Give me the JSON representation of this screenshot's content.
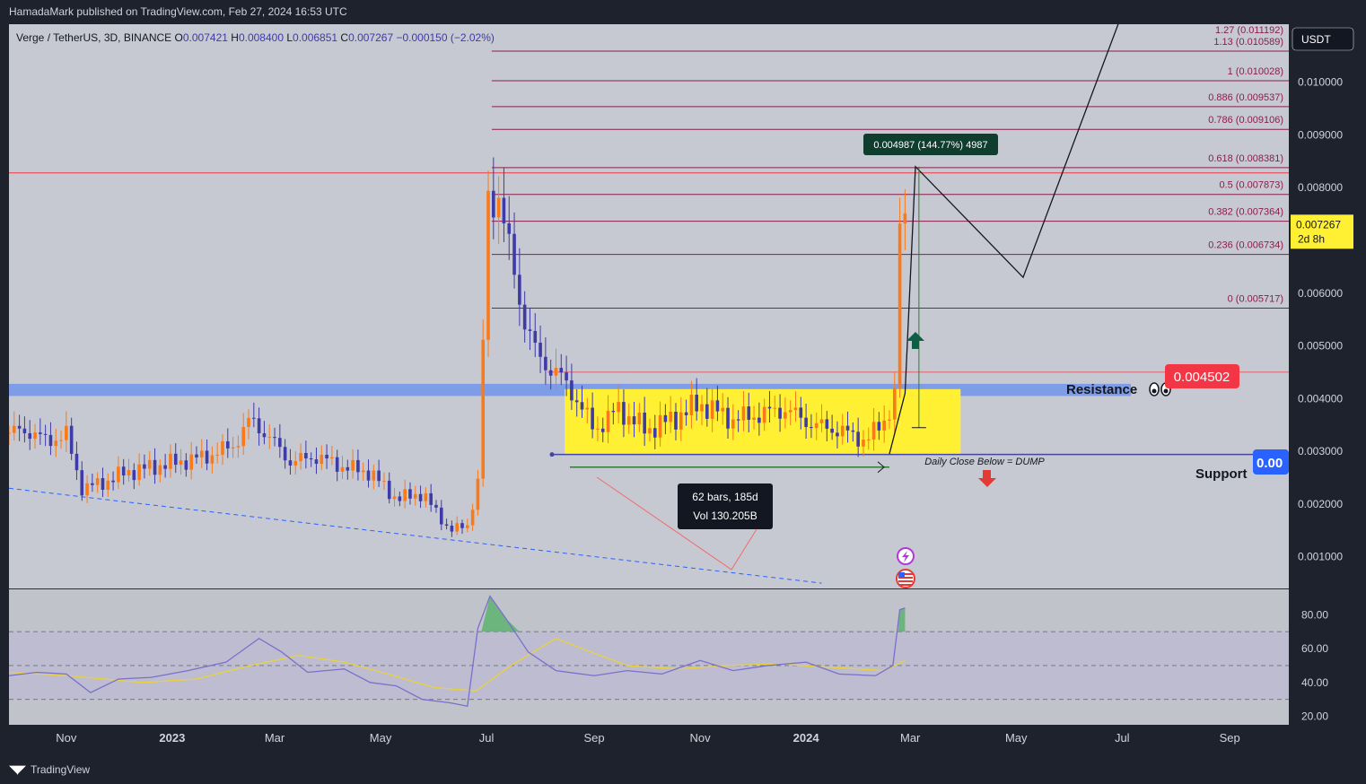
{
  "header": {
    "publisher": "HamadaMark published on TradingView.com, Feb 27, 2024 16:53 UTC"
  },
  "footer": {
    "brand": "TradingView",
    "logo": "tradingview-logo-icon"
  },
  "legend": {
    "symbol": "Verge / TetherUS, 3D, BINANCE",
    "open_label": "O",
    "open": "0.007421",
    "high_label": "H",
    "high": "0.008400",
    "low_label": "L",
    "low": "0.006851",
    "close_label": "C",
    "close": "0.007267",
    "change": "−0.000150 (−2.02%)"
  },
  "currency": "USDT",
  "price_label": {
    "value": "0.007267",
    "countdown": "2d 8h"
  },
  "colors": {
    "background": "#c6c9d1",
    "rsi_background": "#c1c3ca",
    "up": "#fb7a17",
    "down": "#3e3aa8",
    "fib": "#8a1d4c",
    "range_box": "#fff033",
    "resistance_band": "#7f9ce6",
    "support_line": "#4646a0",
    "rsi": "#7b6fcc",
    "rsi_ma": "#e8d23c",
    "resistance_badge": "#f23645",
    "support_badge": "#2962ff",
    "measure_label": "#0f3d2e"
  },
  "chart_data": {
    "type": "candlestick",
    "interval": "3D",
    "x_range": [
      "2022-09-29",
      "2024-10-05"
    ],
    "x_ticks": [
      {
        "date": "2022-11-01",
        "label": "Nov",
        "bold": false
      },
      {
        "date": "2023-01-01",
        "label": "2023",
        "bold": true
      },
      {
        "date": "2023-03-01",
        "label": "Mar",
        "bold": false
      },
      {
        "date": "2023-05-01",
        "label": "May",
        "bold": false
      },
      {
        "date": "2023-07-01",
        "label": "Jul",
        "bold": false
      },
      {
        "date": "2023-09-01",
        "label": "Sep",
        "bold": false
      },
      {
        "date": "2023-11-01",
        "label": "Nov",
        "bold": false
      },
      {
        "date": "2024-01-01",
        "label": "2024",
        "bold": true
      },
      {
        "date": "2024-03-01",
        "label": "Mar",
        "bold": false
      },
      {
        "date": "2024-05-01",
        "label": "May",
        "bold": false
      },
      {
        "date": "2024-07-01",
        "label": "Jul",
        "bold": false
      },
      {
        "date": "2024-09-01",
        "label": "Sep",
        "bold": false
      }
    ],
    "ylim": [
      0.0004,
      0.0111
    ],
    "y_ticks": [
      "0.001000",
      "0.002000",
      "0.003000",
      "0.004000",
      "0.005000",
      "0.006000",
      "0.008000",
      "0.009000",
      "0.010000"
    ],
    "close_path": [
      [
        "2022-09-29",
        0.00335
      ],
      [
        "2022-10-10",
        0.0034
      ],
      [
        "2022-10-20",
        0.0032
      ],
      [
        "2022-11-01",
        0.0033
      ],
      [
        "2022-11-10",
        0.0023
      ],
      [
        "2022-11-22",
        0.0024
      ],
      [
        "2022-12-05",
        0.0026
      ],
      [
        "2022-12-20",
        0.0027
      ],
      [
        "2023-01-05",
        0.0028
      ],
      [
        "2023-01-20",
        0.0029
      ],
      [
        "2023-02-05",
        0.0031
      ],
      [
        "2023-02-15",
        0.0036
      ],
      [
        "2023-02-25",
        0.0033
      ],
      [
        "2023-03-10",
        0.0028
      ],
      [
        "2023-03-25",
        0.0029
      ],
      [
        "2023-04-10",
        0.0027
      ],
      [
        "2023-04-25",
        0.0026
      ],
      [
        "2023-05-10",
        0.0021
      ],
      [
        "2023-05-25",
        0.0022
      ],
      [
        "2023-06-10",
        0.0015
      ],
      [
        "2023-06-20",
        0.0016
      ],
      [
        "2023-06-26",
        0.0024
      ],
      [
        "2023-07-02",
        0.0077
      ],
      [
        "2023-07-08",
        0.0079
      ],
      [
        "2023-07-14",
        0.0068
      ],
      [
        "2023-07-22",
        0.0056
      ],
      [
        "2023-07-30",
        0.0048
      ],
      [
        "2023-08-10",
        0.0045
      ],
      [
        "2023-08-20",
        0.0041
      ],
      [
        "2023-09-01",
        0.0034
      ],
      [
        "2023-09-15",
        0.0038
      ],
      [
        "2023-10-01",
        0.0034
      ],
      [
        "2023-10-15",
        0.0036
      ],
      [
        "2023-11-01",
        0.0039
      ],
      [
        "2023-11-20",
        0.0036
      ],
      [
        "2023-12-05",
        0.0037
      ],
      [
        "2023-12-20",
        0.0038
      ],
      [
        "2024-01-05",
        0.0035
      ],
      [
        "2024-01-20",
        0.0034
      ],
      [
        "2024-02-05",
        0.0032
      ],
      [
        "2024-02-15",
        0.0036
      ],
      [
        "2024-02-21",
        0.004
      ],
      [
        "2024-02-24",
        0.0073
      ],
      [
        "2024-02-27",
        0.007267
      ]
    ],
    "annotations": {
      "fib_levels": [
        {
          "ratio": "0",
          "price": 0.005717,
          "label": "0 (0.005717)"
        },
        {
          "ratio": "0.236",
          "price": 0.006734,
          "label": "0.236 (0.006734)"
        },
        {
          "ratio": "0.382",
          "price": 0.007364,
          "label": "0.382 (0.007364)"
        },
        {
          "ratio": "0.5",
          "price": 0.007873,
          "label": "0.5 (0.007873)"
        },
        {
          "ratio": "0.618",
          "price": 0.008381,
          "label": "0.618 (0.008381)"
        },
        {
          "ratio": "0.786",
          "price": 0.009106,
          "label": "0.786 (0.009106)"
        },
        {
          "ratio": "0.886",
          "price": 0.009537,
          "label": "0.886 (0.009537)"
        },
        {
          "ratio": "1",
          "price": 0.010028,
          "label": "1 (0.010028)"
        },
        {
          "ratio": "1.13",
          "price": 0.010589,
          "label": "1.13 (0.010589)"
        },
        {
          "ratio": "1.27",
          "price": 0.011192,
          "label": "1.27 (0.011192)"
        }
      ],
      "resistance": {
        "label": "Resistance",
        "icon": "eyes-icon",
        "price": "0.004502",
        "band": [
          0.00405,
          0.00428
        ]
      },
      "support": {
        "label": "Support",
        "price_badge": "0.00",
        "price": 0.00294
      },
      "range_box": {
        "from": "2023-08-15",
        "to": "2024-03-30",
        "bottom": 0.00295,
        "top": 0.00418
      },
      "range_measure": {
        "bars": "62 bars, 185d",
        "volume": "Vol 130.205B"
      },
      "price_measure": {
        "label": "0.004987 (144.77%) 4987"
      },
      "daily_close_note": "Daily Close Below = DUMP",
      "projection_path": [
        [
          "2024-02-18",
          0.00295
        ],
        [
          "2024-02-27",
          0.0041
        ],
        [
          "2024-03-04",
          0.0084
        ],
        [
          "2024-05-05",
          0.0063
        ],
        [
          "2024-07-01",
          0.0113
        ]
      ],
      "red_line": 0.00828,
      "trendline": [
        [
          "2022-09-29",
          0.0023
        ],
        [
          "2024-01-10",
          0.0005
        ]
      ],
      "up_arrow": "up-arrow-icon",
      "down_arrow": "down-arrow-icon",
      "event_icons": [
        "lightning-icon",
        "us-flag-icon"
      ]
    },
    "rsi": {
      "ylim": [
        15,
        95
      ],
      "y_ticks": [
        "20.00",
        "40.00",
        "60.00",
        "80.00"
      ],
      "bands": [
        30,
        50,
        70
      ],
      "rsi": [
        [
          "2022-09-29",
          44
        ],
        [
          "2022-10-15",
          46
        ],
        [
          "2022-11-01",
          45
        ],
        [
          "2022-11-15",
          34
        ],
        [
          "2022-12-01",
          42
        ],
        [
          "2022-12-20",
          43
        ],
        [
          "2023-01-10",
          47
        ],
        [
          "2023-02-01",
          52
        ],
        [
          "2023-02-20",
          66
        ],
        [
          "2023-03-05",
          58
        ],
        [
          "2023-03-20",
          46
        ],
        [
          "2023-04-10",
          48
        ],
        [
          "2023-04-25",
          40
        ],
        [
          "2023-05-10",
          38
        ],
        [
          "2023-05-25",
          30
        ],
        [
          "2023-06-10",
          28
        ],
        [
          "2023-06-20",
          26
        ],
        [
          "2023-06-26",
          72
        ],
        [
          "2023-07-03",
          91
        ],
        [
          "2023-07-12",
          78
        ],
        [
          "2023-07-25",
          58
        ],
        [
          "2023-08-10",
          47
        ],
        [
          "2023-09-01",
          44
        ],
        [
          "2023-09-20",
          47
        ],
        [
          "2023-10-10",
          45
        ],
        [
          "2023-11-01",
          53
        ],
        [
          "2023-11-20",
          47
        ],
        [
          "2023-12-10",
          50
        ],
        [
          "2024-01-01",
          52
        ],
        [
          "2024-01-20",
          45
        ],
        [
          "2024-02-10",
          44
        ],
        [
          "2024-02-20",
          50
        ],
        [
          "2024-02-24",
          83
        ],
        [
          "2024-02-27",
          84
        ]
      ],
      "ma": [
        [
          "2022-09-29",
          46
        ],
        [
          "2022-11-01",
          44
        ],
        [
          "2022-12-15",
          40
        ],
        [
          "2023-01-15",
          42
        ],
        [
          "2023-02-15",
          50
        ],
        [
          "2023-03-15",
          56
        ],
        [
          "2023-04-10",
          52
        ],
        [
          "2023-05-05",
          45
        ],
        [
          "2023-06-01",
          37
        ],
        [
          "2023-06-25",
          35
        ],
        [
          "2023-07-15",
          50
        ],
        [
          "2023-08-10",
          66
        ],
        [
          "2023-08-25",
          60
        ],
        [
          "2023-09-20",
          50
        ],
        [
          "2023-10-20",
          48
        ],
        [
          "2023-11-15",
          50
        ],
        [
          "2023-12-15",
          51
        ],
        [
          "2024-01-15",
          49
        ],
        [
          "2024-02-15",
          47
        ],
        [
          "2024-02-27",
          53
        ]
      ]
    }
  }
}
